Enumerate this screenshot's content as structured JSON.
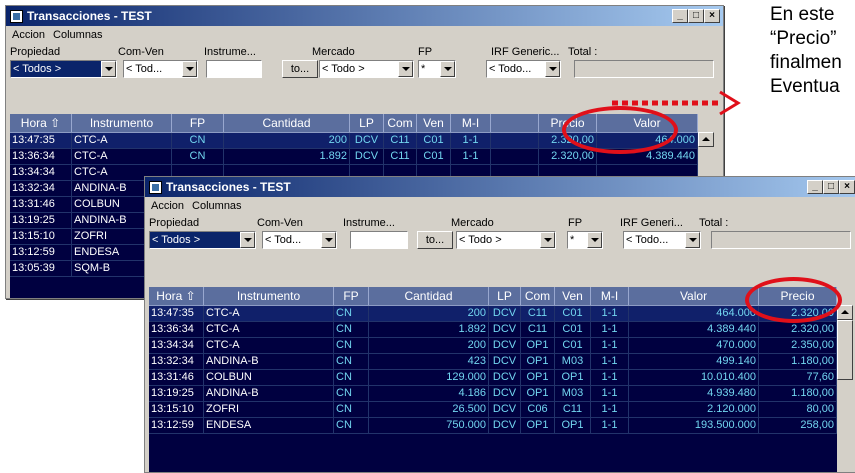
{
  "side_text": {
    "line1": "En este",
    "line2": "“Precio”",
    "line3": "finalmen",
    "line4": "Eventua"
  },
  "window1": {
    "title": "Transacciones - TEST",
    "menu": [
      "Accion",
      "Columnas"
    ],
    "filter_labels": [
      "Propiedad",
      "Com-Ven",
      "Instrume...",
      "Mercado",
      "FP",
      "IRF Generic...",
      "Total :"
    ],
    "combos": {
      "propiedad": "< Todos >",
      "comven": "< Tod...",
      "instrumento": "",
      "to_btn": "to...",
      "mercado": "< Todo >",
      "fp": "*",
      "irf": "< Todo..."
    },
    "columns": [
      "Hora",
      "Instrumento",
      "FP",
      "Cantidad",
      "LP",
      "Com",
      "Ven",
      "M-I",
      "",
      "Precio",
      "Valor"
    ],
    "rows": [
      {
        "hora": "13:47:35",
        "inst": "CTC-A",
        "fp": "CN",
        "cant": "200",
        "lp": "DCV",
        "com": "C11",
        "ven": "C01",
        "mi": "1-1",
        "precio": "2.320,00",
        "valor": "464.000"
      },
      {
        "hora": "13:36:34",
        "inst": "CTC-A",
        "fp": "CN",
        "cant": "1.892",
        "lp": "DCV",
        "com": "C11",
        "ven": "C01",
        "mi": "1-1",
        "precio": "2.320,00",
        "valor": "4.389.440"
      },
      {
        "hora": "13:34:34",
        "inst": "CTC-A",
        "fp": "",
        "cant": "",
        "lp": "",
        "com": "",
        "ven": "",
        "mi": "",
        "precio": "",
        "valor": ""
      },
      {
        "hora": "13:32:34",
        "inst": "ANDINA-B",
        "fp": "",
        "cant": "",
        "lp": "",
        "com": "",
        "ven": "",
        "mi": "",
        "precio": "",
        "valor": ""
      },
      {
        "hora": "13:31:46",
        "inst": "COLBUN",
        "fp": "",
        "cant": "",
        "lp": "",
        "com": "",
        "ven": "",
        "mi": "",
        "precio": "",
        "valor": ""
      },
      {
        "hora": "13:19:25",
        "inst": "ANDINA-B",
        "fp": "",
        "cant": "",
        "lp": "",
        "com": "",
        "ven": "",
        "mi": "",
        "precio": "",
        "valor": ""
      },
      {
        "hora": "13:15:10",
        "inst": "ZOFRI",
        "fp": "",
        "cant": "",
        "lp": "",
        "com": "",
        "ven": "",
        "mi": "",
        "precio": "",
        "valor": ""
      },
      {
        "hora": "13:12:59",
        "inst": "ENDESA",
        "fp": "",
        "cant": "",
        "lp": "",
        "com": "",
        "ven": "",
        "mi": "",
        "precio": "",
        "valor": ""
      },
      {
        "hora": "13:05:39",
        "inst": "SQM-B",
        "fp": "",
        "cant": "",
        "lp": "",
        "com": "",
        "ven": "",
        "mi": "",
        "precio": "",
        "valor": ""
      }
    ]
  },
  "window2": {
    "title": "Transacciones - TEST",
    "menu": [
      "Accion",
      "Columnas"
    ],
    "filter_labels": [
      "Propiedad",
      "Com-Ven",
      "Instrume...",
      "Mercado",
      "FP",
      "IRF Generi...",
      "Total :"
    ],
    "combos": {
      "propiedad": "< Todos >",
      "comven": "< Tod...",
      "instrumento": "",
      "to_btn": "to...",
      "mercado": "< Todo >",
      "fp": "*",
      "irf": "< Todo..."
    },
    "columns": [
      "Hora",
      "Instrumento",
      "FP",
      "Cantidad",
      "LP",
      "Com",
      "Ven",
      "M-I",
      "Valor",
      "Precio"
    ],
    "rows": [
      {
        "hora": "13:47:35",
        "inst": "CTC-A",
        "fp": "CN",
        "cant": "200",
        "lp": "DCV",
        "com": "C11",
        "ven": "C01",
        "mi": "1-1",
        "valor": "464.000",
        "precio": "2.320,00"
      },
      {
        "hora": "13:36:34",
        "inst": "CTC-A",
        "fp": "CN",
        "cant": "1.892",
        "lp": "DCV",
        "com": "C11",
        "ven": "C01",
        "mi": "1-1",
        "valor": "4.389.440",
        "precio": "2.320,00"
      },
      {
        "hora": "13:34:34",
        "inst": "CTC-A",
        "fp": "CN",
        "cant": "200",
        "lp": "DCV",
        "com": "OP1",
        "ven": "C01",
        "mi": "1-1",
        "valor": "470.000",
        "precio": "2.350,00"
      },
      {
        "hora": "13:32:34",
        "inst": "ANDINA-B",
        "fp": "CN",
        "cant": "423",
        "lp": "DCV",
        "com": "OP1",
        "ven": "M03",
        "mi": "1-1",
        "valor": "499.140",
        "precio": "1.180,00"
      },
      {
        "hora": "13:31:46",
        "inst": "COLBUN",
        "fp": "CN",
        "cant": "129.000",
        "lp": "DCV",
        "com": "OP1",
        "ven": "OP1",
        "mi": "1-1",
        "valor": "10.010.400",
        "precio": "77,60"
      },
      {
        "hora": "13:19:25",
        "inst": "ANDINA-B",
        "fp": "CN",
        "cant": "4.186",
        "lp": "DCV",
        "com": "OP1",
        "ven": "M03",
        "mi": "1-1",
        "valor": "4.939.480",
        "precio": "1.180,00"
      },
      {
        "hora": "13:15:10",
        "inst": "ZOFRI",
        "fp": "CN",
        "cant": "26.500",
        "lp": "DCV",
        "com": "C06",
        "ven": "C11",
        "mi": "1-1",
        "valor": "2.120.000",
        "precio": "80,00"
      },
      {
        "hora": "13:12:59",
        "inst": "ENDESA",
        "fp": "CN",
        "cant": "750.000",
        "lp": "DCV",
        "com": "OP1",
        "ven": "OP1",
        "mi": "1-1",
        "valor": "193.500.000",
        "precio": "258,00"
      }
    ]
  },
  "colors": {
    "highlight": "#e0101a",
    "grid_bg": "#000040",
    "title_blue": "#0a246a"
  }
}
